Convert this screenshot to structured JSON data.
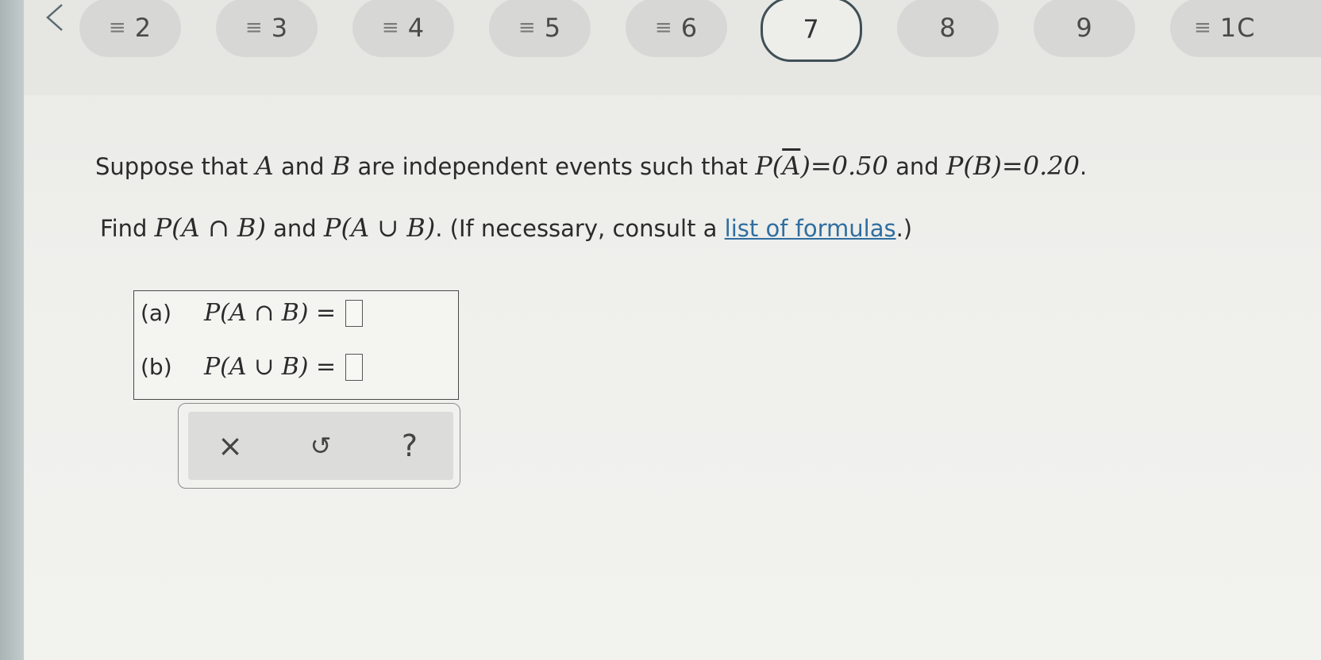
{
  "nav": {
    "back_icon": "chevron-left-icon",
    "questions": [
      {
        "number": "2",
        "answered": true
      },
      {
        "number": "3",
        "answered": true
      },
      {
        "number": "4",
        "answered": true
      },
      {
        "number": "5",
        "answered": true
      },
      {
        "number": "6",
        "answered": true
      },
      {
        "number": "7",
        "answered": false,
        "active": true
      },
      {
        "number": "8",
        "answered": false
      },
      {
        "number": "9",
        "answered": false
      },
      {
        "number": "1C",
        "answered": true
      }
    ],
    "answered_marker": "≡"
  },
  "problem": {
    "l1_a": "Suppose that ",
    "var_a": "A",
    "l1_b": " and ",
    "var_b": "B",
    "l1_c": " are independent events such that ",
    "p_abar_prefix": "P(",
    "p_abar_var": "A",
    "p_abar_suffix": ")=0.50",
    "l1_d": " and ",
    "p_b": "P(B)=0.20",
    "l1_e": ".",
    "l2_a": "Find ",
    "p_intersect": "P(A ∩ B)",
    "l2_b": " and ",
    "p_union": "P(A ∪ B)",
    "l2_c": ". (If necessary, consult a ",
    "link_text": "list of formulas",
    "l2_d": ".)"
  },
  "answers": {
    "a_label": "(a)",
    "a_expr": "P(A ∩ B) =",
    "a_value": "",
    "b_label": "(b)",
    "b_expr": "P(A ∪ B) =",
    "b_value": ""
  },
  "toolbar": {
    "clear_glyph": "×",
    "undo_glyph": "↺",
    "help_glyph": "?"
  },
  "colors": {
    "link": "#2f6ea0",
    "active_ring": "#3f4f55",
    "pill": "#d7d7d5"
  }
}
